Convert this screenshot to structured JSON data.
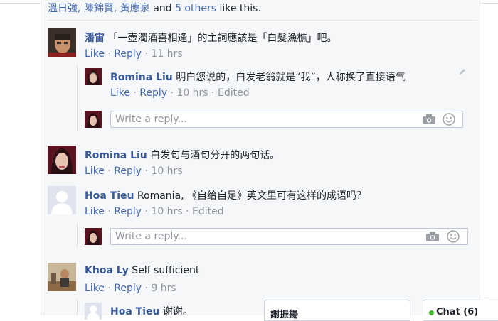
{
  "likes": {
    "names": "溫日強, 陳錦賢, 黃應泉",
    "and": " and ",
    "others": "5 others",
    "suffix": " like this."
  },
  "comments": [
    {
      "author": "潘宙",
      "text": " 「一壺濁酒喜相逢」的主詞應該是「白髮漁樵」吧。",
      "like": "Like",
      "reply": "Reply",
      "time": "11 hrs",
      "replies": [
        {
          "author": "Romina Liu",
          "text": " 明白您说的，白发老翁就是“我”，人称换了直接语气",
          "like": "Like",
          "reply": "Reply",
          "time": "10 hrs",
          "edited": "Edited"
        }
      ]
    },
    {
      "author": "Romina Liu",
      "text": " 白发句与酒句分开的两句话。",
      "like": "Like",
      "reply": "Reply",
      "time": "10 hrs"
    },
    {
      "author": "Hoa Tieu",
      "text": " Romania, 《自给自足》英文里可有这样的成语吗？",
      "like": "Like",
      "reply": "Reply",
      "time": "10 hrs",
      "edited": "Edited"
    },
    {
      "author": "Khoa Ly",
      "text": " Self sufficient",
      "like": "Like",
      "reply": "Reply",
      "time": "9 hrs",
      "replies": [
        {
          "author": "Hoa Tieu",
          "text": " 谢谢。"
        }
      ]
    }
  ],
  "reply_box": {
    "placeholder": "Write a reply..."
  },
  "chat": {
    "window_title": "謝振揚",
    "tab_label": "Chat (6)"
  },
  "colors": {
    "link": "#4267b2",
    "name": "#365899",
    "meta": "#90949c",
    "online": "#42b72a"
  }
}
